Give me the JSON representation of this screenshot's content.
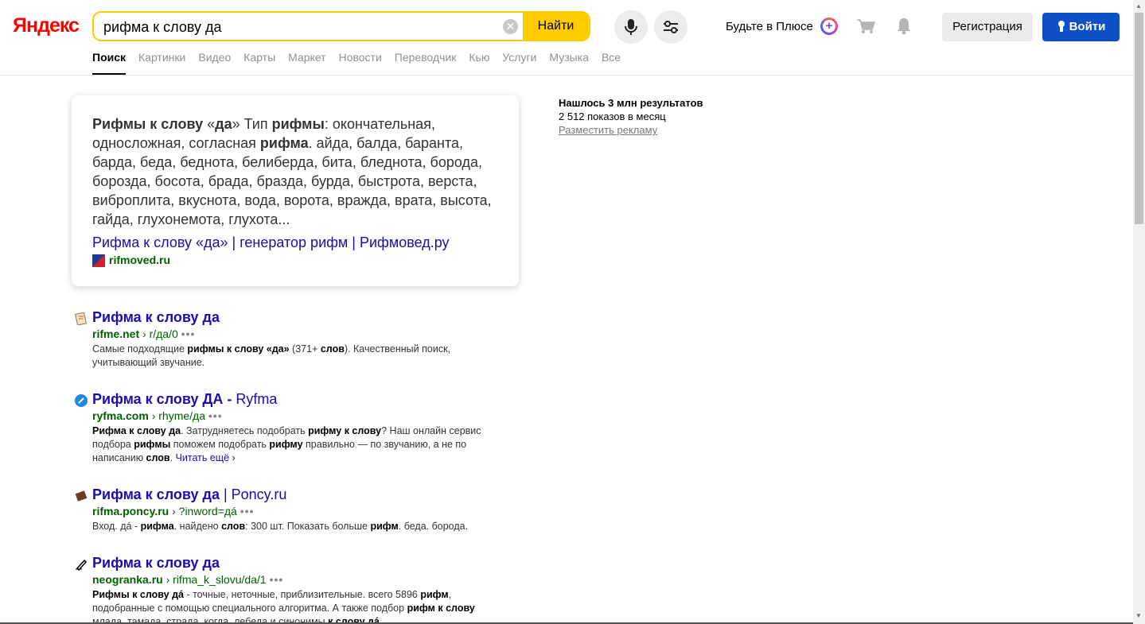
{
  "header": {
    "logo": "Яндекс",
    "search_value": "рифма к слову да",
    "clear_label": "✕",
    "find_label": "Найти",
    "plus_text": "Будьте в Плюсе",
    "register_label": "Регистрация",
    "login_label": "Войти"
  },
  "tabs": [
    "Поиск",
    "Картинки",
    "Видео",
    "Карты",
    "Маркет",
    "Новости",
    "Переводчик",
    "Кью",
    "Услуги",
    "Музыка",
    "Все"
  ],
  "snippet": {
    "text_html": "<b>Рифмы к слову</b> «<b>да</b>» Тип <b>рифмы</b>: окончательная, односложная, согласная <b>рифма</b>. айда, балда, баранта, барда, беда, беднота, белиберда, бита, бледнота, борода, борозда, босота, брада, бразда, бурда, быстрота, верста, виброплита, вкуснота, вода, ворота, вражда, врата, высота, гайда, глухонемота, глухота...",
    "link": "Рифма к слову «да» | генератор рифм | Рифмовед.ру",
    "domain": "rifmoved.ru"
  },
  "stats": {
    "found": "Нашлось 3 млн результатов",
    "shows": "2 512 показов в месяц",
    "ad": "Разместить рекламу"
  },
  "results": [
    {
      "title_html": "<b>Рифма к слову да</b>",
      "domain": "rifme.net",
      "path": "r/да/0",
      "desc_html": "Самые подходящие <b>рифмы к слову «да»</b> (371+ <b>слов</b>). Качественный поиск, учитывающий звучание."
    },
    {
      "title_html": "<b>Рифма к слову ДА -</b> Ryfma",
      "domain": "ryfma.com",
      "path": "rhyme/да",
      "desc_html": "<b>Рифма к слову да</b>. Затрудняетесь подобрать <b>рифму к слову</b>? Наш онлайн сервис подбора <b>рифмы</b> поможем подобрать <b>рифму</b> правильно — по звучанию, а не по написанию <b>слов</b>. <span class=\"more\">Читать ещё ›</span>"
    },
    {
      "title_html": "<b>Рифма к слову да</b> | Poncy.ru",
      "domain": "rifma.poncy.ru",
      "path": "?inword=дá",
      "desc_html": "Вход. дá - <b>рифма</b>. найдено <b>слов</b>: 300 шт. Показать больше <b>рифм</b>. беда. борода."
    },
    {
      "title_html": "<b>Рифма к слову да</b>",
      "domain": "neogranka.ru",
      "path": "rifma_k_slovu/da/1",
      "desc_html": "<b>Рифмы к слову дá</b> - точные, неточные, приблизительные. всего 5896 <b>рифм</b>, подобранные с помощью специального алгоритма. А также подбор <b>рифм к слову</b> млада, тамада, страда, когда, лебеда и синонимы <b>к слову дá</b>."
    }
  ]
}
